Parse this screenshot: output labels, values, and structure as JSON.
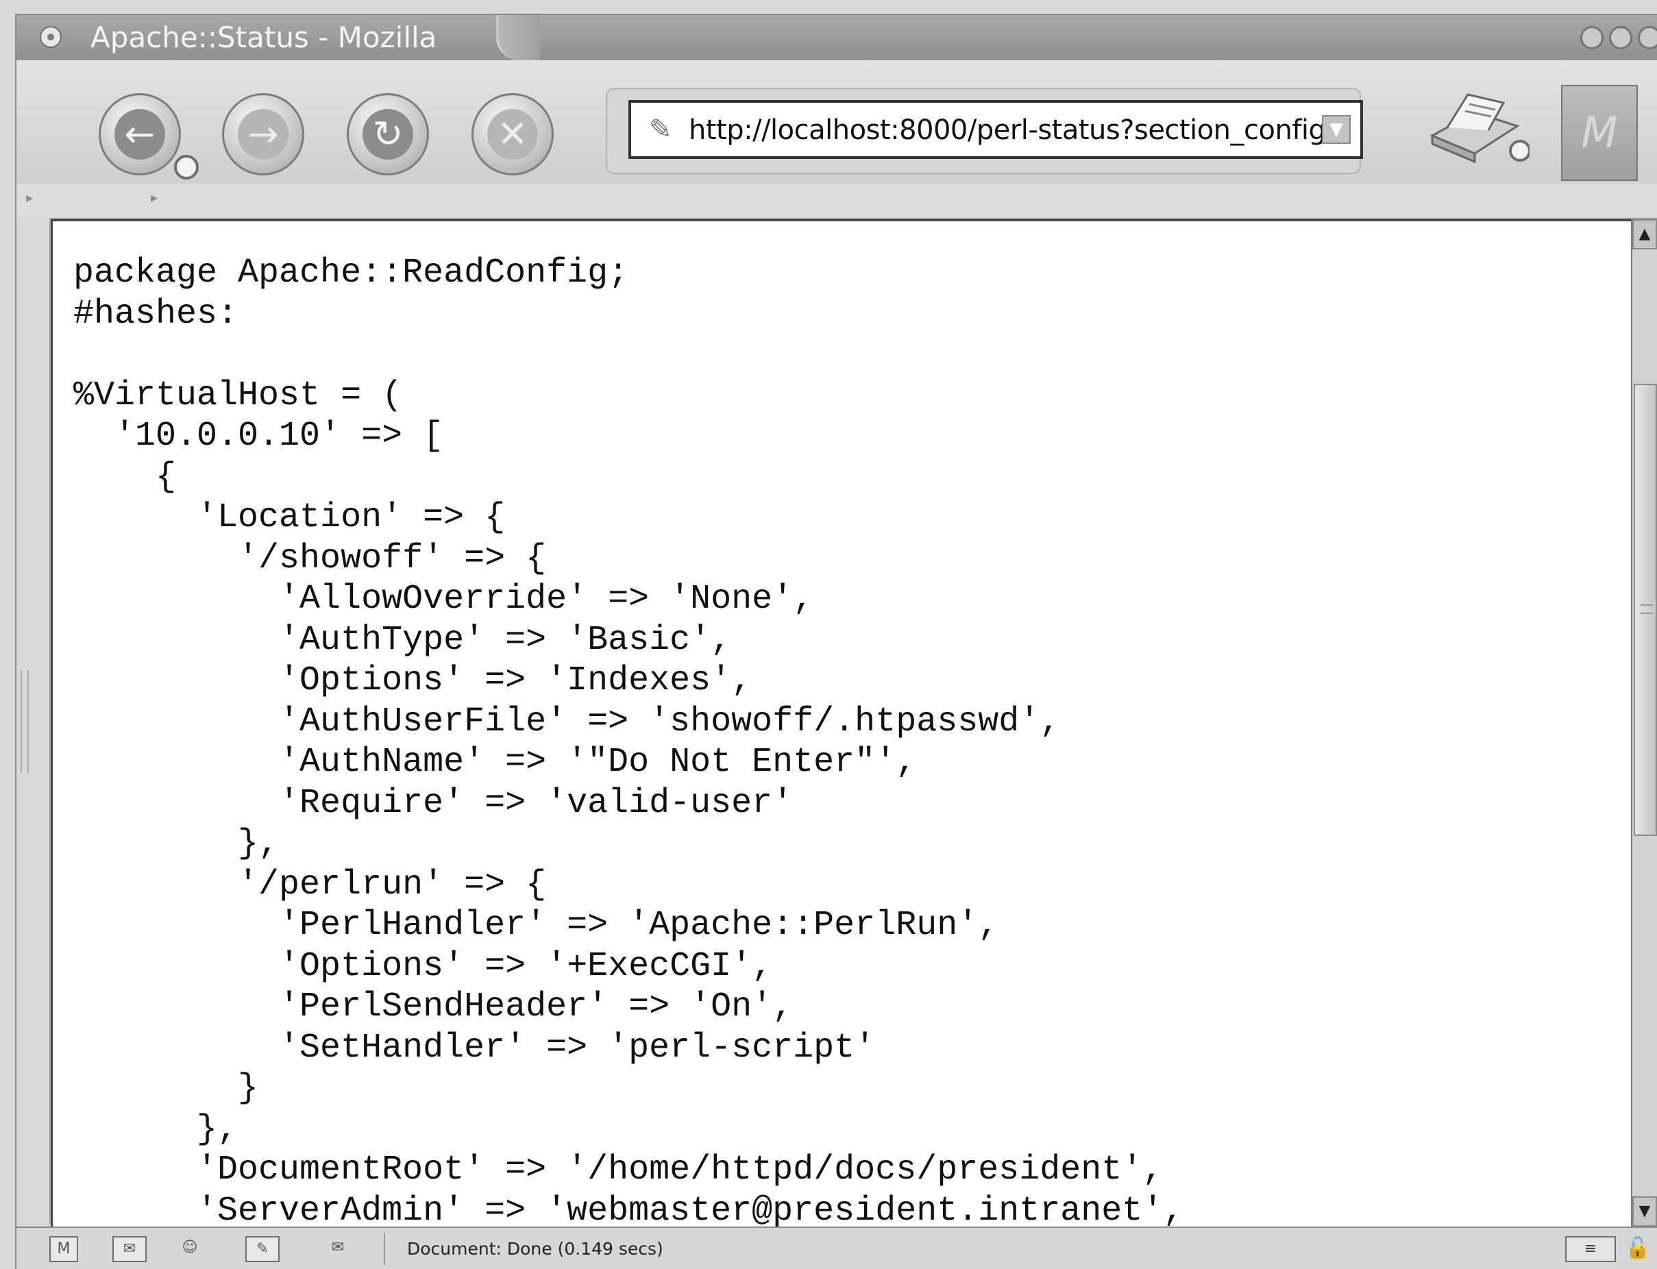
{
  "window": {
    "title": "Apache::Status - Mozilla"
  },
  "toolbar": {
    "back_icon": "back-arrow-icon",
    "forward_icon": "forward-arrow-icon",
    "reload_icon": "reload-icon",
    "stop_icon": "stop-icon",
    "url": "http://localhost:8000/perl-status?section_config",
    "print_icon": "print-icon",
    "brand_icon": "mozilla-m-icon"
  },
  "content": {
    "code": "package Apache::ReadConfig;\n#hashes:\n\n%VirtualHost = (\n  '10.0.0.10' => [\n    {\n      'Location' => {\n        '/showoff' => {\n          'AllowOverride' => 'None',\n          'AuthType' => 'Basic',\n          'Options' => 'Indexes',\n          'AuthUserFile' => 'showoff/.htpasswd',\n          'AuthName' => '\"Do Not Enter\"',\n          'Require' => 'valid-user'\n        },\n        '/perlrun' => {\n          'PerlHandler' => 'Apache::PerlRun',\n          'Options' => '+ExecCGI',\n          'PerlSendHeader' => 'On',\n          'SetHandler' => 'perl-script'\n        }\n      },\n      'DocumentRoot' => '/home/httpd/docs/president',\n      'ServerAdmin' => 'webmaster@president.intranet',"
  },
  "statusbar": {
    "text": "Document: Done (0.149 secs)"
  }
}
